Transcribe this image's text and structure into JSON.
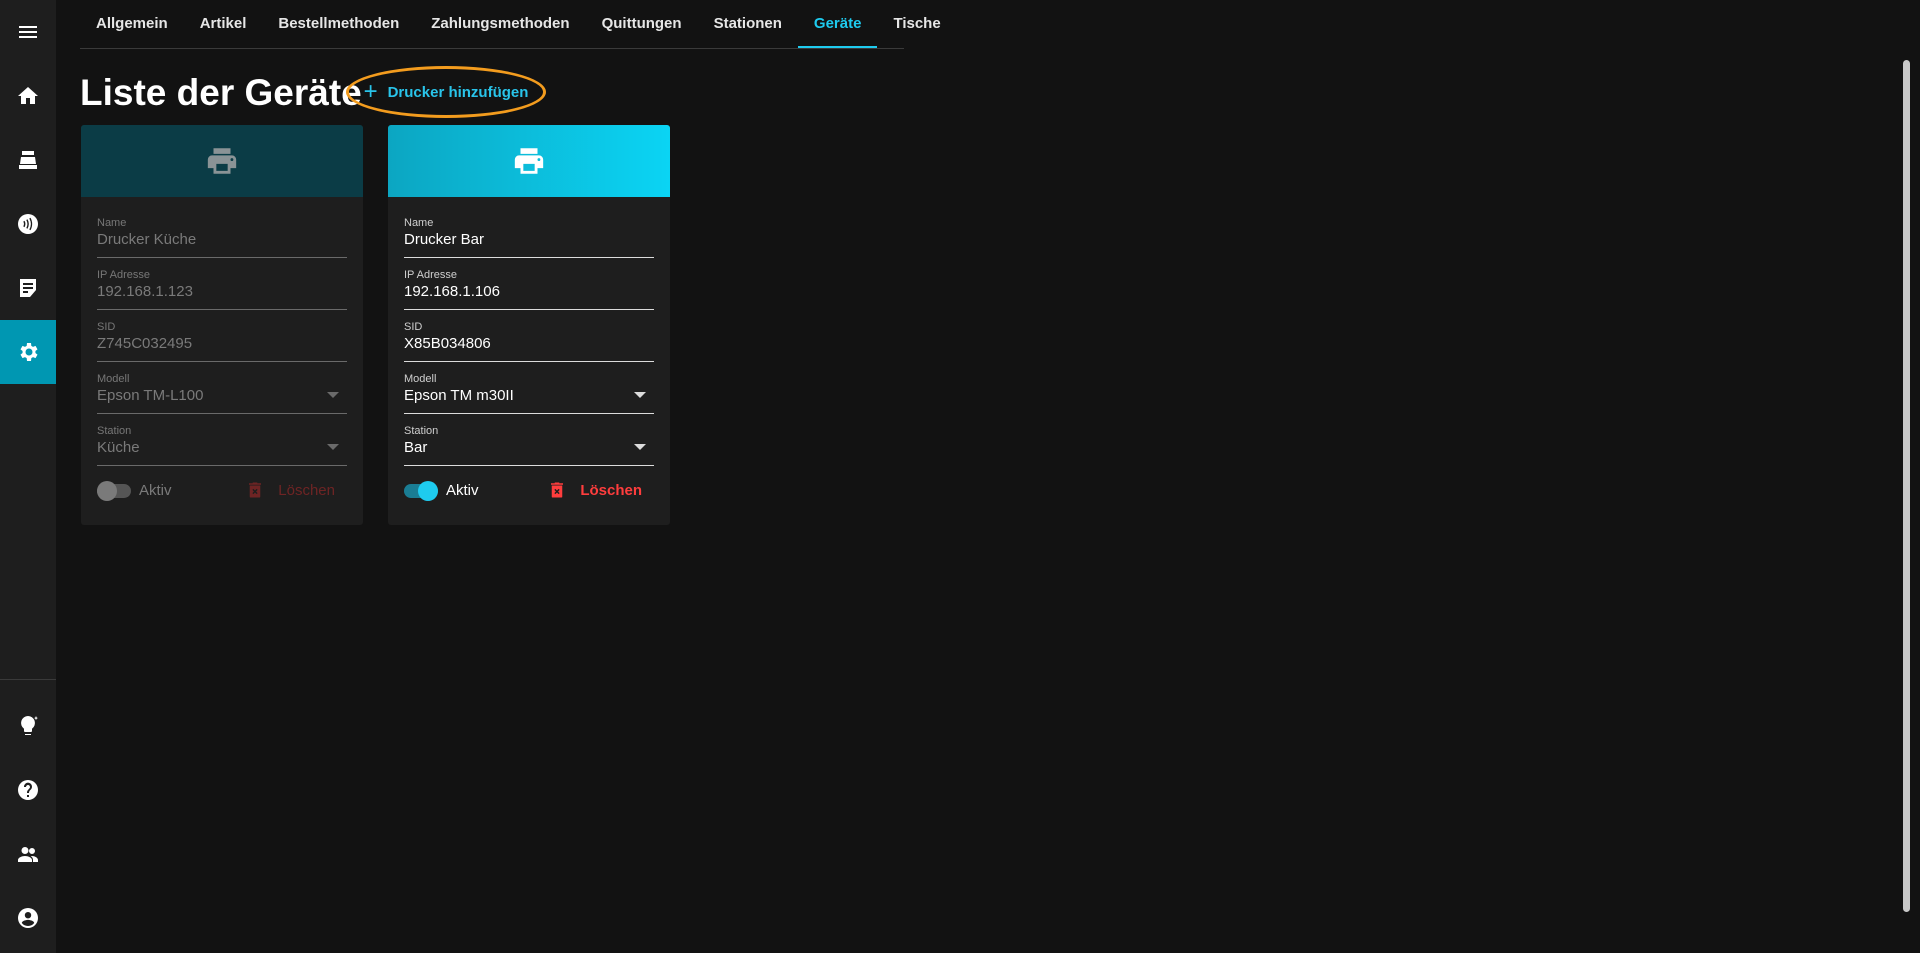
{
  "sidebar": {
    "items": [
      {
        "icon": "menu-icon"
      },
      {
        "icon": "home-icon"
      },
      {
        "icon": "cash-register-icon"
      },
      {
        "icon": "contactless-icon"
      },
      {
        "icon": "orders-icon"
      },
      {
        "icon": "gear-icon",
        "active": true
      }
    ],
    "bottom_items": [
      {
        "icon": "lightbulb-icon"
      },
      {
        "icon": "help-icon"
      },
      {
        "icon": "users-icon"
      },
      {
        "icon": "account-icon"
      }
    ]
  },
  "tabs": [
    {
      "label": "Allgemein"
    },
    {
      "label": "Artikel"
    },
    {
      "label": "Bestellmethoden"
    },
    {
      "label": "Zahlungsmethoden"
    },
    {
      "label": "Quittungen"
    },
    {
      "label": "Stationen"
    },
    {
      "label": "Geräte",
      "active": true
    },
    {
      "label": "Tische"
    }
  ],
  "page": {
    "title": "Liste der Geräte",
    "add_button_label": "Drucker hinzufügen"
  },
  "colors": {
    "accent": "#1ecbef",
    "active_sidebar": "#0097b2",
    "highlight_ring": "#f39c1e",
    "delete": "#ff3d3d"
  },
  "devices": [
    {
      "enabled": false,
      "header_icon": "printer-icon",
      "name_label": "Name",
      "name": "Drucker Küche",
      "ip_label": "IP Adresse",
      "ip": "192.168.1.123",
      "sid_label": "SID",
      "sid": "Z745C032495",
      "model_label": "Modell",
      "model": "Epson TM-L100",
      "station_label": "Station",
      "station": "Küche",
      "active_label": "Aktiv",
      "delete_label": "Löschen"
    },
    {
      "enabled": true,
      "header_icon": "printer-icon",
      "name_label": "Name",
      "name": "Drucker Bar",
      "ip_label": "IP Adresse",
      "ip": "192.168.1.106",
      "sid_label": "SID",
      "sid": "X85B034806",
      "model_label": "Modell",
      "model": "Epson TM m30II",
      "station_label": "Station",
      "station": "Bar",
      "active_label": "Aktiv",
      "delete_label": "Löschen"
    }
  ]
}
